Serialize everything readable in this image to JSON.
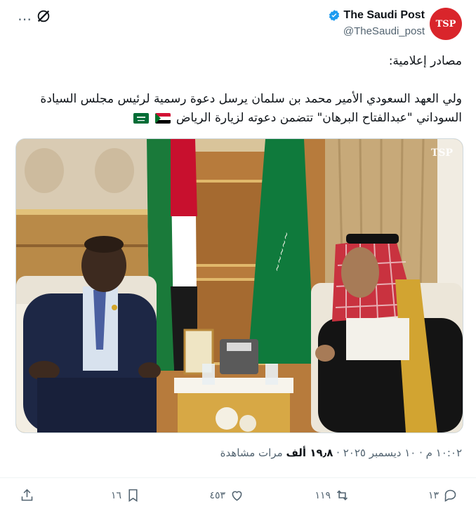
{
  "author": {
    "display_name": "The Saudi Post",
    "handle": "@TheSaudi_post",
    "avatar_text": "TSP"
  },
  "tweet": {
    "line_source": "مصادر إعلامية:",
    "line_main": "ولي العهد السعودي الأمير محمد بن سلمان يرسل دعوة رسمية لرئيس مجلس السيادة السوداني \"عبدالفتاح البرهان\" تتضمن دعوته لزيارة الرياض"
  },
  "image": {
    "watermark": "TSP"
  },
  "meta": {
    "time": "١٠:٠٢ م",
    "date": "١٠ ديسمبر ٢٠٢٥",
    "views_count": "١٩٫٨ ألف",
    "views_label": "مرات مشاهدة"
  },
  "actions": {
    "replies": "١٣",
    "reposts": "١١٩",
    "likes": "٤٥٣",
    "bookmarks": "١٦"
  },
  "colors": {
    "brand": "#d9252b",
    "verified": "#1d9bf0",
    "muted": "#536471"
  }
}
